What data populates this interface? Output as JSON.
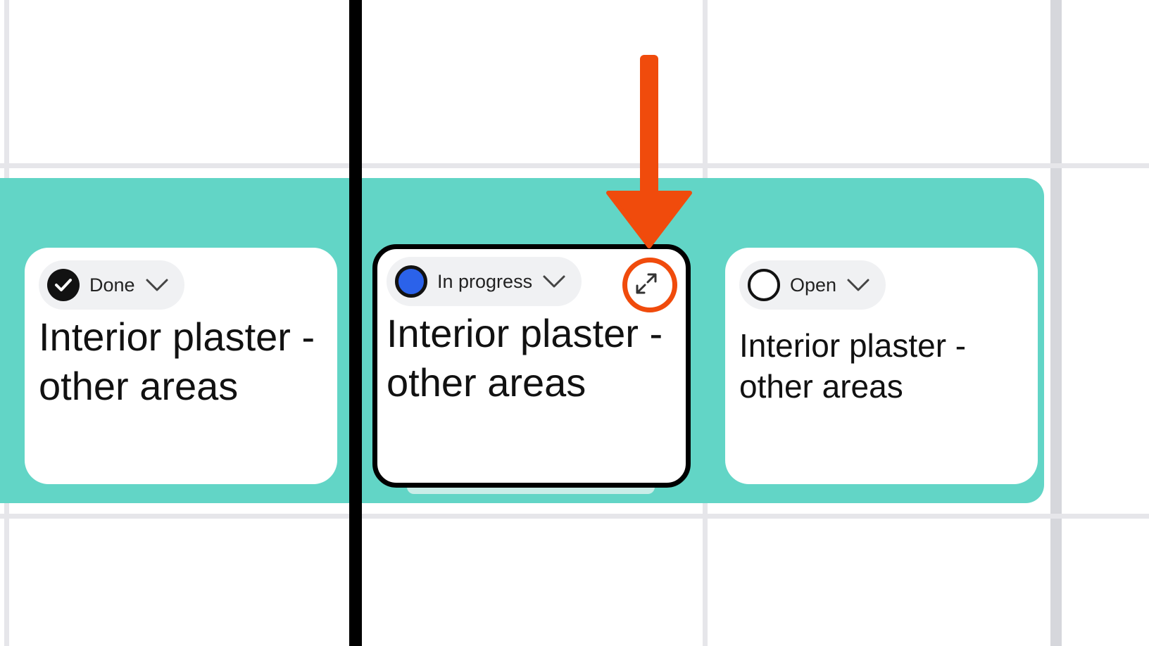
{
  "cards": [
    {
      "status": "Done",
      "status_icon": "check-circle-icon",
      "title": "Interior plaster - other areas"
    },
    {
      "status": "In progress",
      "status_icon": "filled-blue-circle-icon",
      "title": "Interior plaster - other areas",
      "selected": true,
      "action_icon": "expand-icon"
    },
    {
      "status": "Open",
      "status_icon": "empty-circle-icon",
      "title": "Interior plaster  - other areas"
    }
  ],
  "colors": {
    "swimlane": "#62d5c6",
    "today_line": "#000000",
    "in_progress": "#2b62ea",
    "annotation": "#f04b0c",
    "grid": "#e6e6ea"
  },
  "annotation": {
    "arrow_icon": "down-arrow-icon",
    "highlight": "circle-highlight"
  }
}
